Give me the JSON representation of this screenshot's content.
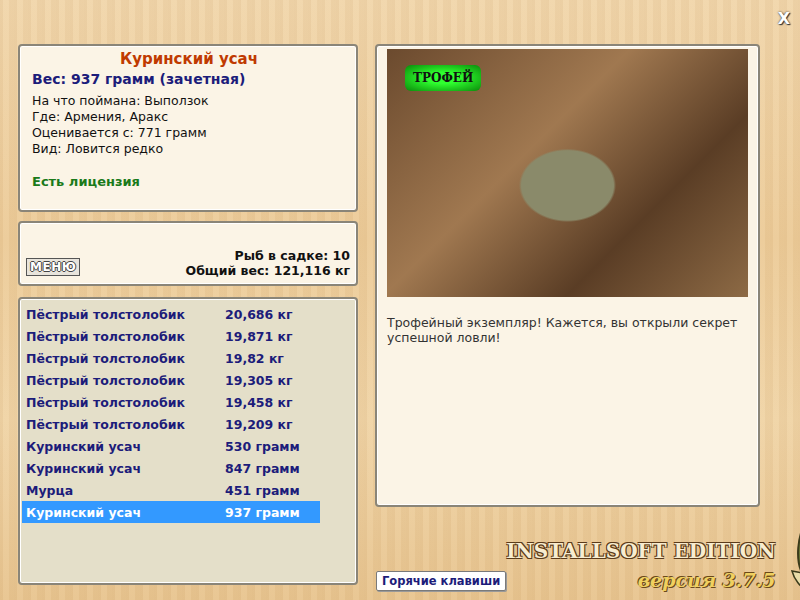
{
  "close": "X",
  "fish": {
    "name": "Куринский усач",
    "weight": "Вес: 937 грамм (зачетная)",
    "details": [
      "На что поймана: Выползок",
      "Где: Армения, Аракс",
      "Оценивается с: 771 грамм",
      "Вид: Ловится редко"
    ],
    "license": "Есть лицензия"
  },
  "keepnet": {
    "menu": "МЕНЮ",
    "count": "Рыб в садке: 10",
    "total": "Общий вес: 121,116 кг"
  },
  "catch_list": [
    {
      "name": "Пёстрый толстолобик",
      "weight": "20,686 кг",
      "selected": false
    },
    {
      "name": "Пёстрый толстолобик",
      "weight": "19,871 кг",
      "selected": false
    },
    {
      "name": "Пёстрый толстолобик",
      "weight": "19,82 кг",
      "selected": false
    },
    {
      "name": "Пёстрый толстолобик",
      "weight": "19,305 кг",
      "selected": false
    },
    {
      "name": "Пёстрый толстолобик",
      "weight": "19,458 кг",
      "selected": false
    },
    {
      "name": "Пёстрый толстолобик",
      "weight": "19,209 кг",
      "selected": false
    },
    {
      "name": "Куринский усач",
      "weight": "530 грамм",
      "selected": false
    },
    {
      "name": "Куринский усач",
      "weight": "847 грамм",
      "selected": false
    },
    {
      "name": "Мурца",
      "weight": "451 грамм",
      "selected": false
    },
    {
      "name": "Куринский усач",
      "weight": "937 грамм",
      "selected": true
    }
  ],
  "photo": {
    "badge": "ТРОФЕЙ"
  },
  "message": "Трофейный экземпляр! Кажется, вы открыли секрет успешной ловли!",
  "hotkeys_button": "Горячие клавиши",
  "brand": {
    "title": "INSTALLSOFT EDITION",
    "version": "версия 3.7.5"
  }
}
